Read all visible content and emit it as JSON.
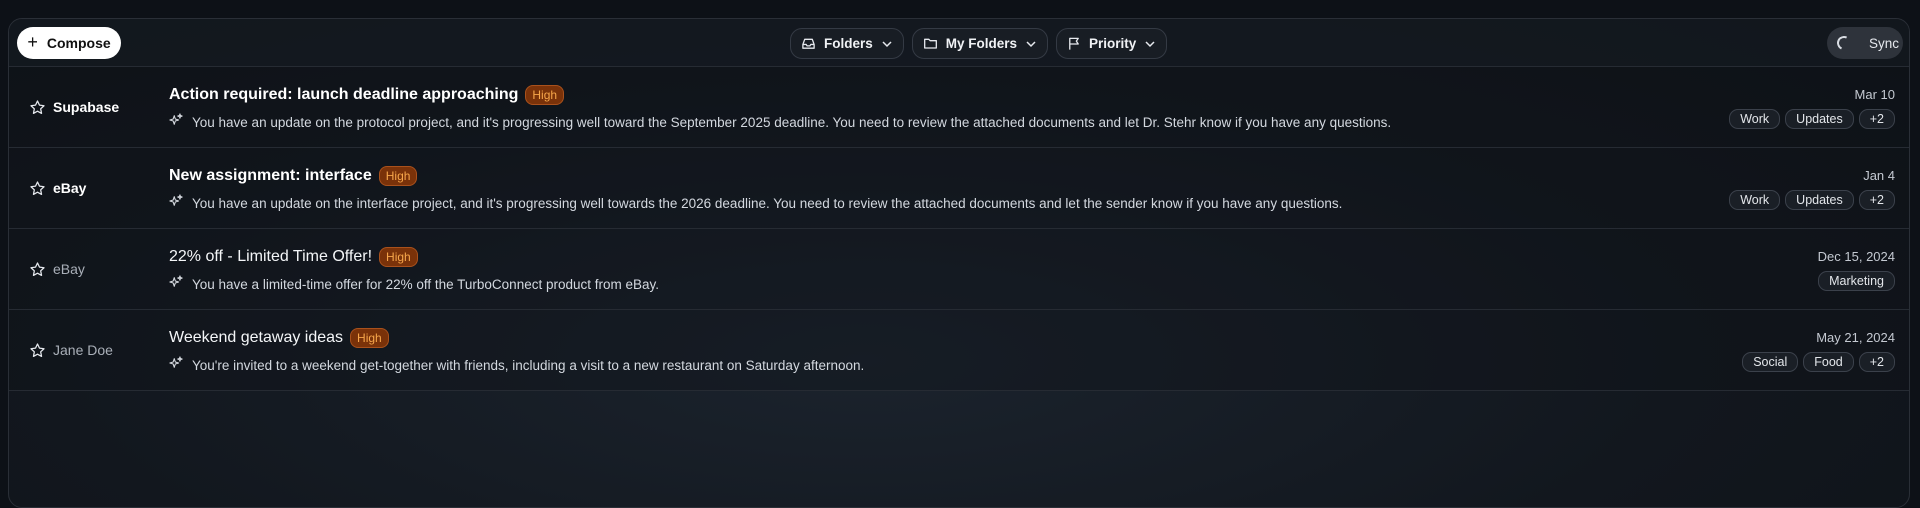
{
  "toolbar": {
    "compose_label": "Compose",
    "filters": [
      {
        "label": "Folders",
        "icon": "inbox-icon"
      },
      {
        "label": "My Folders",
        "icon": "folder-icon"
      },
      {
        "label": "Priority",
        "icon": "flag-icon"
      }
    ],
    "sync_label": "Sync"
  },
  "emails": [
    {
      "sender": "Supabase",
      "unread": true,
      "subject": "Action required: launch deadline approaching",
      "priority": "High",
      "snippet": "You have an update on the protocol project, and it's progressing well toward the September 2025 deadline. You need to review the attached documents and let Dr. Stehr know if you have any questions.",
      "date": "Mar 10",
      "tags": [
        "Work",
        "Updates",
        "+2"
      ]
    },
    {
      "sender": "eBay",
      "unread": true,
      "subject": "New assignment: interface",
      "priority": "High",
      "snippet": "You have an update on the interface project, and it's progressing well towards the 2026 deadline. You need to review the attached documents and let the sender know if you have any questions.",
      "date": "Jan 4",
      "tags": [
        "Work",
        "Updates",
        "+2"
      ]
    },
    {
      "sender": "eBay",
      "unread": false,
      "subject": "22% off - Limited Time Offer!",
      "priority": "High",
      "snippet": "You have a limited-time offer for 22% off the TurboConnect product from eBay.",
      "date": "Dec 15, 2024",
      "tags": [
        "Marketing"
      ]
    },
    {
      "sender": "Jane Doe",
      "unread": false,
      "subject": "Weekend getaway ideas",
      "priority": "High",
      "snippet": "You're invited to a weekend get-together with friends, including a visit to a new restaurant on Saturday afternoon.",
      "date": "May 21, 2024",
      "tags": [
        "Social",
        "Food",
        "+2"
      ]
    }
  ]
}
